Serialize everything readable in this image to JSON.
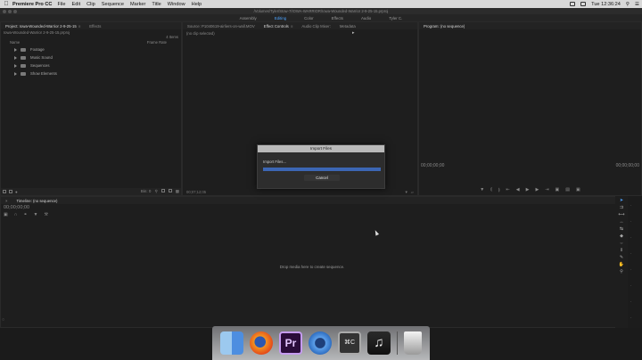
{
  "menubar": {
    "app_name": "Premiere Pro CC",
    "menus": [
      "File",
      "Edit",
      "Clip",
      "Sequence",
      "Marker",
      "Title",
      "Window",
      "Help"
    ],
    "clock": "Tue 12:36:24"
  },
  "titlebar": {
    "path": "/Volumes/Tyler/Stow-7/IOWA-WARRIOR/Iowa-Wounded-Warrior 2-9-25-15.prproj"
  },
  "workspaces": [
    "Assembly",
    "Editing",
    "Color",
    "Effects",
    "Audio",
    "Tyler C."
  ],
  "project_panel": {
    "tabs": [
      "Project: Iowa-Wounded-Warrior 2-9-25-15",
      "Effects"
    ],
    "file_name": "Iowa-Wounded-Warrior 2-9-25-15.prproj",
    "item_count": "4 Items",
    "col_name": "Name",
    "col_frame_rate": "Frame Rate",
    "bins": [
      "Footage",
      "Music Sound",
      "Sequences",
      "Show Elements"
    ],
    "bin_count": "Bin: 0"
  },
  "source_panel": {
    "tabs": [
      "Source: P1040619-airliers-on-wall.MOV",
      "Effect Controls",
      "Audio Clip Mixer:",
      "Metadata"
    ],
    "no_clip": "(no clip selected)",
    "timecode": "00;07;12;05"
  },
  "program_panel": {
    "title": "Program: (no sequence)",
    "timecode_left": "00;00;00;00",
    "timecode_right": "00;00;00;00"
  },
  "timeline_panel": {
    "title": "Timeline: (no sequence)",
    "timecode": "00;00;00;00",
    "drop_text": "Drop media here to create sequence."
  },
  "import_dialog": {
    "title": "Import Files",
    "status": "Import Files...",
    "progress": 1.0,
    "cancel_label": "Cancel"
  },
  "dock": {
    "apps": [
      "finder-icon",
      "firefox-icon",
      "premiere-icon",
      "quicktime-icon",
      "keyboard-icon",
      "itunes-icon",
      "trash-icon"
    ],
    "premiere_label": "Pr",
    "keyc_label": "⌘C",
    "music_glyph": "♫"
  },
  "colors": {
    "accent": "#4da3ff",
    "progress": "#3c66b4"
  }
}
